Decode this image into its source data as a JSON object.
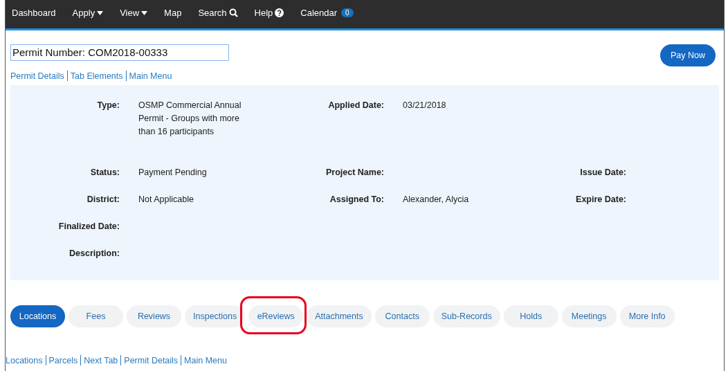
{
  "nav": [
    {
      "label": "Dashboard",
      "kind": "link"
    },
    {
      "label": "Apply",
      "kind": "menu"
    },
    {
      "label": "View",
      "kind": "menu"
    },
    {
      "label": "Map",
      "kind": "link"
    },
    {
      "label": "Search",
      "kind": "search"
    },
    {
      "label": "Help",
      "kind": "help"
    },
    {
      "label": "Calendar",
      "kind": "link",
      "badge": "0"
    }
  ],
  "permit_number": "Permit Number: COM2018-00333",
  "pay_button": "Pay Now",
  "top_links": [
    "Permit Details",
    "Tab Elements",
    "Main Menu"
  ],
  "details": [
    [
      {
        "label": "Type:",
        "value": "OSMP Commercial Annual Permit - Groups with more than 16 participants"
      },
      {
        "label": "Applied Date:",
        "value": "03/21/2018"
      }
    ],
    [
      {
        "label": "Status:",
        "value": "Payment Pending"
      },
      {
        "label": "Project Name:"
      },
      {
        "label": "Issue Date:"
      }
    ],
    [
      {
        "label": "District:",
        "value": "Not Applicable"
      },
      {
        "label": "Assigned To:",
        "value": "Alexander, Alycia"
      },
      {
        "label": "Expire Date:"
      }
    ],
    [
      {
        "label": "Finalized Date:"
      }
    ],
    [
      {
        "label": "Description:"
      }
    ]
  ],
  "tabs": [
    {
      "label": "Locations",
      "selected": true,
      "highlighted": false
    },
    {
      "label": "Fees",
      "selected": false,
      "highlighted": false
    },
    {
      "label": "Reviews",
      "selected": false,
      "highlighted": false
    },
    {
      "label": "Inspections",
      "selected": false,
      "highlighted": false
    },
    {
      "label": "eReviews",
      "selected": false,
      "highlighted": true
    },
    {
      "label": "Attachments",
      "selected": false,
      "highlighted": false
    },
    {
      "label": "Contacts",
      "selected": false,
      "highlighted": false
    },
    {
      "label": "Sub-Records",
      "selected": false,
      "highlighted": false
    },
    {
      "label": "Holds",
      "selected": false,
      "highlighted": false
    },
    {
      "label": "Meetings",
      "selected": false,
      "highlighted": false
    },
    {
      "label": "More Info",
      "selected": false,
      "highlighted": false
    }
  ],
  "bottom_links": [
    "Locations",
    "Parcels",
    "Next Tab",
    "Permit Details",
    "Main Menu"
  ]
}
